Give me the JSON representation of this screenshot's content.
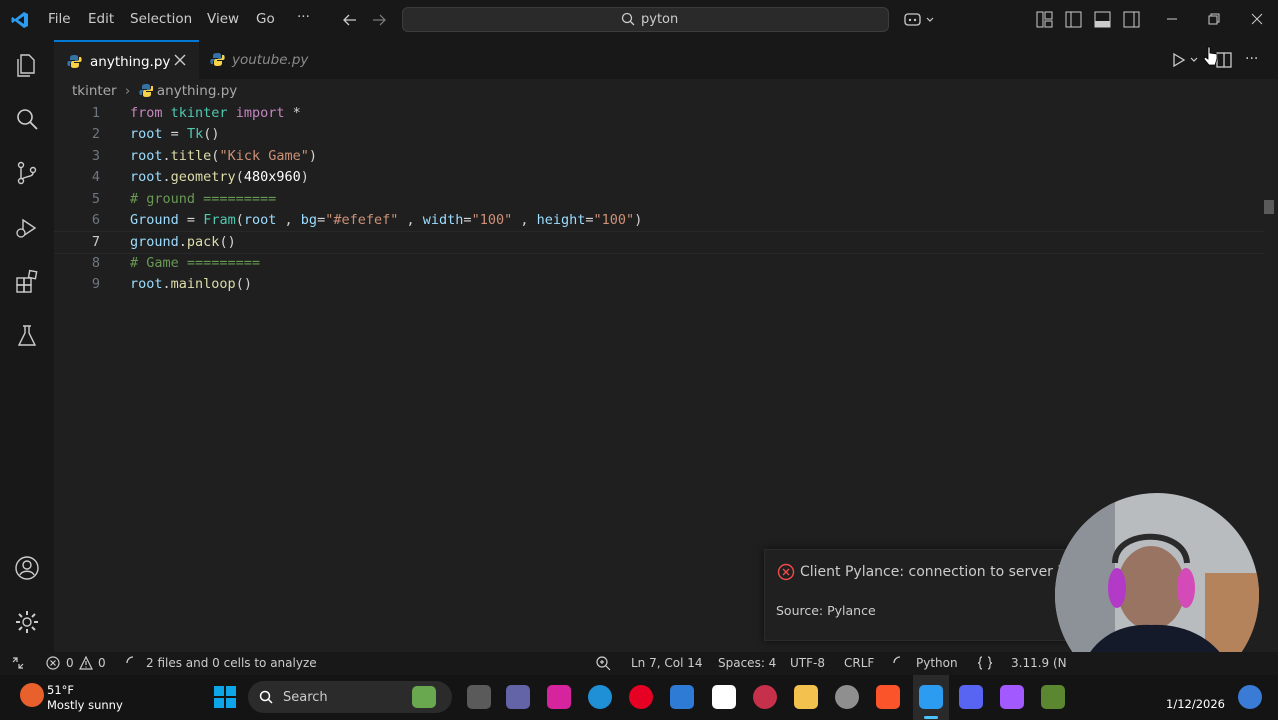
{
  "menu": {
    "file": "File",
    "edit": "Edit",
    "selection": "Selection",
    "view": "View",
    "go": "Go",
    "more": "···"
  },
  "search": {
    "value": "pyton"
  },
  "tabs": [
    {
      "label": "anything.py",
      "active": true
    },
    {
      "label": "youtube.py",
      "active": false
    }
  ],
  "breadcrumb": {
    "folder": "tkinter",
    "file": "anything.py"
  },
  "code_lines": [
    {
      "n": "1",
      "text": "from tkinter import *"
    },
    {
      "n": "2",
      "text": "root = Tk()"
    },
    {
      "n": "3",
      "text": "root.title(\"Kick Game\")"
    },
    {
      "n": "4",
      "text": "root.geometry(480x960)"
    },
    {
      "n": "5",
      "text": "# ground ========="
    },
    {
      "n": "6",
      "text": "Ground = Fram(root , bg=\"#efefef\" , width=\"100\" , height=\"100\")"
    },
    {
      "n": "7",
      "text": "ground.pack()"
    },
    {
      "n": "8",
      "text": "# Game ========="
    },
    {
      "n": "9",
      "text": "root.mainloop()"
    }
  ],
  "notification": {
    "message": "Client Pylance: connection to server is e",
    "source": "Source: Pylance"
  },
  "status": {
    "errors": "0",
    "warnings": "0",
    "analyze": "2 files and 0 cells to analyze",
    "position": "Ln 7, Col 14",
    "spaces": "Spaces: 4",
    "encoding": "UTF-8",
    "eol": "CRLF",
    "language": "Python",
    "version": "3.11.9 (N"
  },
  "taskbar": {
    "temp": "51°F",
    "weather": "Mostly sunny",
    "search": "Search",
    "date": "1/12/2026"
  },
  "colors": {
    "accent": "#0078d4",
    "keyword": "#c586c0",
    "function": "#dcdcaa",
    "string": "#ce9178",
    "comment": "#6a9955",
    "variable": "#9cdcfe",
    "class": "#4ec9b0",
    "number": "#b5cea8"
  }
}
